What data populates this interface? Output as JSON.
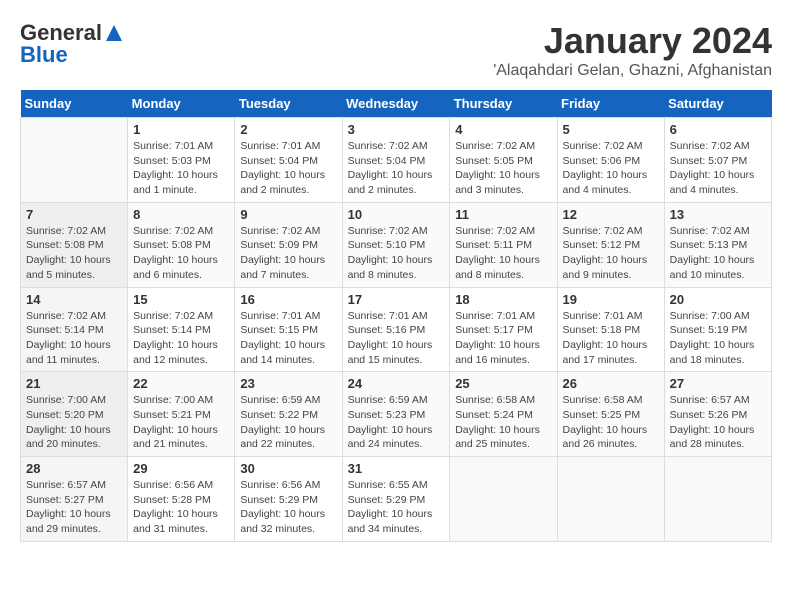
{
  "header": {
    "logo_general": "General",
    "logo_blue": "Blue",
    "month": "January 2024",
    "location": "'Alaqahdari Gelan, Ghazni, Afghanistan"
  },
  "days_of_week": [
    "Sunday",
    "Monday",
    "Tuesday",
    "Wednesday",
    "Thursday",
    "Friday",
    "Saturday"
  ],
  "weeks": [
    [
      {
        "num": "",
        "info": ""
      },
      {
        "num": "1",
        "info": "Sunrise: 7:01 AM\nSunset: 5:03 PM\nDaylight: 10 hours\nand 1 minute."
      },
      {
        "num": "2",
        "info": "Sunrise: 7:01 AM\nSunset: 5:04 PM\nDaylight: 10 hours\nand 2 minutes."
      },
      {
        "num": "3",
        "info": "Sunrise: 7:02 AM\nSunset: 5:04 PM\nDaylight: 10 hours\nand 2 minutes."
      },
      {
        "num": "4",
        "info": "Sunrise: 7:02 AM\nSunset: 5:05 PM\nDaylight: 10 hours\nand 3 minutes."
      },
      {
        "num": "5",
        "info": "Sunrise: 7:02 AM\nSunset: 5:06 PM\nDaylight: 10 hours\nand 4 minutes."
      },
      {
        "num": "6",
        "info": "Sunrise: 7:02 AM\nSunset: 5:07 PM\nDaylight: 10 hours\nand 4 minutes."
      }
    ],
    [
      {
        "num": "7",
        "info": "Sunrise: 7:02 AM\nSunset: 5:08 PM\nDaylight: 10 hours\nand 5 minutes."
      },
      {
        "num": "8",
        "info": "Sunrise: 7:02 AM\nSunset: 5:08 PM\nDaylight: 10 hours\nand 6 minutes."
      },
      {
        "num": "9",
        "info": "Sunrise: 7:02 AM\nSunset: 5:09 PM\nDaylight: 10 hours\nand 7 minutes."
      },
      {
        "num": "10",
        "info": "Sunrise: 7:02 AM\nSunset: 5:10 PM\nDaylight: 10 hours\nand 8 minutes."
      },
      {
        "num": "11",
        "info": "Sunrise: 7:02 AM\nSunset: 5:11 PM\nDaylight: 10 hours\nand 8 minutes."
      },
      {
        "num": "12",
        "info": "Sunrise: 7:02 AM\nSunset: 5:12 PM\nDaylight: 10 hours\nand 9 minutes."
      },
      {
        "num": "13",
        "info": "Sunrise: 7:02 AM\nSunset: 5:13 PM\nDaylight: 10 hours\nand 10 minutes."
      }
    ],
    [
      {
        "num": "14",
        "info": "Sunrise: 7:02 AM\nSunset: 5:14 PM\nDaylight: 10 hours\nand 11 minutes."
      },
      {
        "num": "15",
        "info": "Sunrise: 7:02 AM\nSunset: 5:14 PM\nDaylight: 10 hours\nand 12 minutes."
      },
      {
        "num": "16",
        "info": "Sunrise: 7:01 AM\nSunset: 5:15 PM\nDaylight: 10 hours\nand 14 minutes."
      },
      {
        "num": "17",
        "info": "Sunrise: 7:01 AM\nSunset: 5:16 PM\nDaylight: 10 hours\nand 15 minutes."
      },
      {
        "num": "18",
        "info": "Sunrise: 7:01 AM\nSunset: 5:17 PM\nDaylight: 10 hours\nand 16 minutes."
      },
      {
        "num": "19",
        "info": "Sunrise: 7:01 AM\nSunset: 5:18 PM\nDaylight: 10 hours\nand 17 minutes."
      },
      {
        "num": "20",
        "info": "Sunrise: 7:00 AM\nSunset: 5:19 PM\nDaylight: 10 hours\nand 18 minutes."
      }
    ],
    [
      {
        "num": "21",
        "info": "Sunrise: 7:00 AM\nSunset: 5:20 PM\nDaylight: 10 hours\nand 20 minutes."
      },
      {
        "num": "22",
        "info": "Sunrise: 7:00 AM\nSunset: 5:21 PM\nDaylight: 10 hours\nand 21 minutes."
      },
      {
        "num": "23",
        "info": "Sunrise: 6:59 AM\nSunset: 5:22 PM\nDaylight: 10 hours\nand 22 minutes."
      },
      {
        "num": "24",
        "info": "Sunrise: 6:59 AM\nSunset: 5:23 PM\nDaylight: 10 hours\nand 24 minutes."
      },
      {
        "num": "25",
        "info": "Sunrise: 6:58 AM\nSunset: 5:24 PM\nDaylight: 10 hours\nand 25 minutes."
      },
      {
        "num": "26",
        "info": "Sunrise: 6:58 AM\nSunset: 5:25 PM\nDaylight: 10 hours\nand 26 minutes."
      },
      {
        "num": "27",
        "info": "Sunrise: 6:57 AM\nSunset: 5:26 PM\nDaylight: 10 hours\nand 28 minutes."
      }
    ],
    [
      {
        "num": "28",
        "info": "Sunrise: 6:57 AM\nSunset: 5:27 PM\nDaylight: 10 hours\nand 29 minutes."
      },
      {
        "num": "29",
        "info": "Sunrise: 6:56 AM\nSunset: 5:28 PM\nDaylight: 10 hours\nand 31 minutes."
      },
      {
        "num": "30",
        "info": "Sunrise: 6:56 AM\nSunset: 5:29 PM\nDaylight: 10 hours\nand 32 minutes."
      },
      {
        "num": "31",
        "info": "Sunrise: 6:55 AM\nSunset: 5:29 PM\nDaylight: 10 hours\nand 34 minutes."
      },
      {
        "num": "",
        "info": ""
      },
      {
        "num": "",
        "info": ""
      },
      {
        "num": "",
        "info": ""
      }
    ]
  ]
}
